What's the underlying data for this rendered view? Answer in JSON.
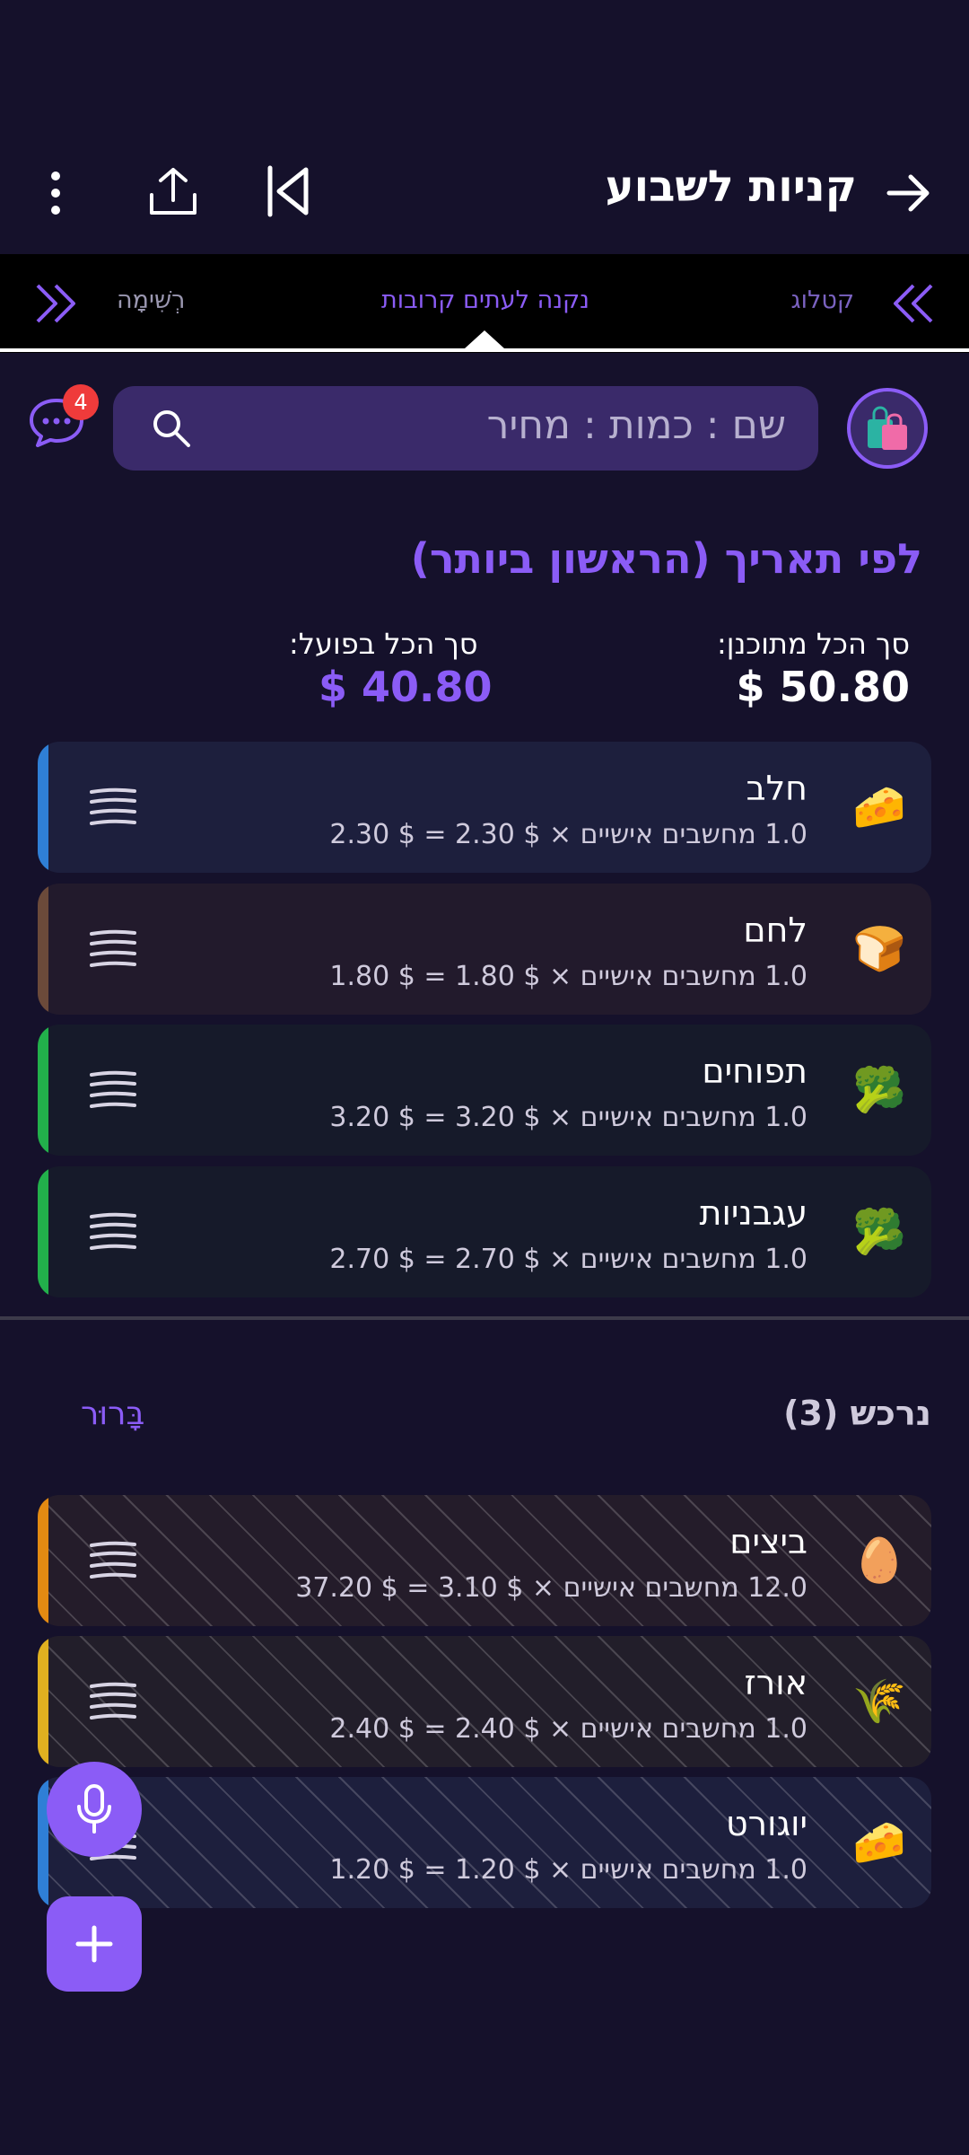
{
  "app": {
    "title": "קניות לשבוע"
  },
  "tabs": {
    "left": "רְשִׁימָה",
    "center": "נקנה לעתים קרובות",
    "right": "קטלוג"
  },
  "search": {
    "placeholder": "שם : כמות : מחיר"
  },
  "chat": {
    "badge": "4"
  },
  "sort": {
    "title": "לפי תאריך (הראשון ביותר)"
  },
  "totals": {
    "planned_label": "סך הכל מתוכנן:",
    "planned_value": "$ 50.80",
    "actual_label": "סך הכל בפועל:",
    "actual_value": "$ 40.80"
  },
  "items": [
    {
      "name": "חלב",
      "detail": "1.0 מחשבים אישיים × $ 2.30 = $ 2.30",
      "icon": "cheese-icon",
      "emoji": "🧀",
      "stripe": "#2f7fd6",
      "bg": "#1d1f3d"
    },
    {
      "name": "לחם",
      "detail": "1.0 מחשבים אישיים × $ 1.80 = $ 1.80",
      "icon": "bread-icon",
      "emoji": "🍞",
      "stripe": "#6b4a3a",
      "bg": "#221a2c"
    },
    {
      "name": "תפוחים",
      "detail": "1.0 מחשבים אישיים × $ 3.20 = $ 3.20",
      "icon": "broccoli-icon",
      "emoji": "🥦",
      "stripe": "#22b04b",
      "bg": "#161a2a"
    },
    {
      "name": "עגבניות",
      "detail": "1.0 מחשבים אישיים × $ 2.70 = $ 2.70",
      "icon": "broccoli-icon",
      "emoji": "🥦",
      "stripe": "#22b04b",
      "bg": "#161a2a"
    }
  ],
  "done": {
    "title": "נרכש (3)",
    "clear": "בָּרוּר",
    "items": [
      {
        "name": "ביצים",
        "detail": "12.0 מחשבים אישיים × $ 3.10 = $ 37.20",
        "icon": "egg-icon",
        "emoji": "🥚",
        "stripe": "#e38a12",
        "bg": "#241c2a"
      },
      {
        "name": "אורז",
        "detail": "1.0 מחשבים אישיים × $ 2.40 = $ 2.40",
        "icon": "rice-icon",
        "emoji": "🌾",
        "stripe": "#e0b020",
        "bg": "#221e2a"
      },
      {
        "name": "יוגורט",
        "detail": "1.0 מחשבים אישיים × $ 1.20 = $ 1.20",
        "icon": "cheese-icon",
        "emoji": "🧀",
        "stripe": "#2f7fd6",
        "bg": "#1d1f3d"
      }
    ]
  },
  "colors": {
    "accent": "#8b5cf6",
    "background": "#15112b"
  }
}
